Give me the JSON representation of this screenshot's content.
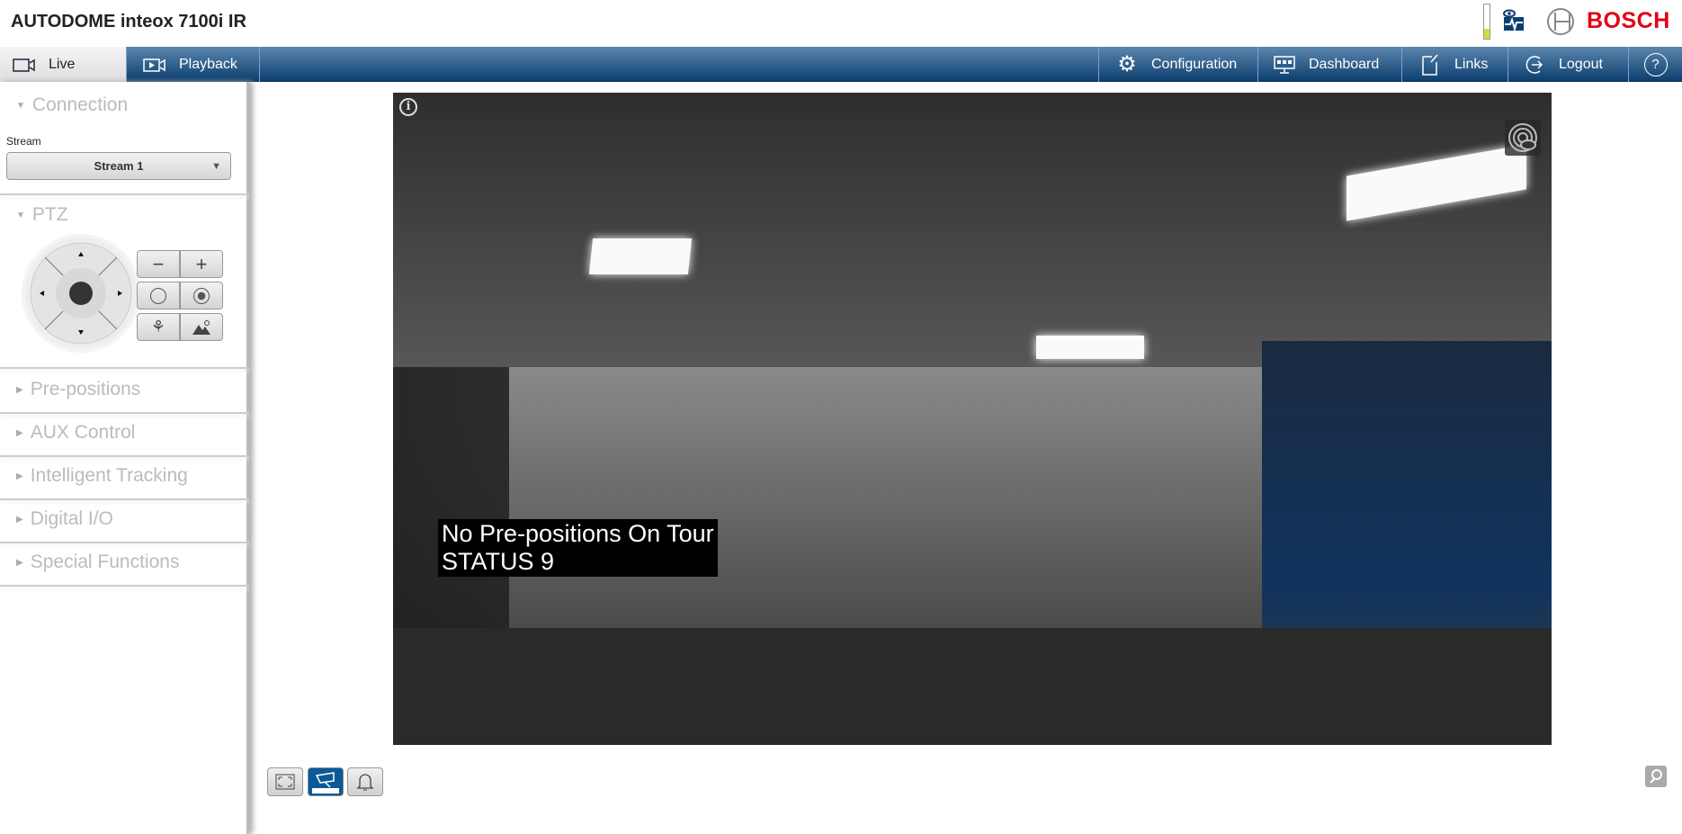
{
  "header": {
    "title": "AUTODOME inteox 7100i IR",
    "brand": "BOSCH",
    "level_fraction": 0.3,
    "level_color": "#d4dd3a",
    "brand_color": "#e20015"
  },
  "nav": {
    "left": [
      {
        "label": "Live",
        "icon": "camera-icon",
        "active": true
      },
      {
        "label": "Playback",
        "icon": "playback-icon"
      }
    ],
    "right": [
      {
        "label": "Configuration",
        "icon": "gear-icon"
      },
      {
        "label": "Dashboard",
        "icon": "monitor-icon"
      },
      {
        "label": "Links",
        "icon": "link-icon"
      },
      {
        "label": "Logout",
        "icon": "logout-icon"
      },
      {
        "label": "?",
        "icon": "help-icon"
      }
    ]
  },
  "sidebar": {
    "connection": {
      "title": "Connection",
      "stream_label": "Stream",
      "stream_value": "Stream 1"
    },
    "ptz": {
      "title": "PTZ",
      "zoom_out": "−",
      "zoom_in": "+"
    },
    "sections": [
      "Pre-positions",
      "AUX Control",
      "Intelligent Tracking",
      "Digital I/O",
      "Special Functions"
    ]
  },
  "video": {
    "overlay_line1": "No Pre-positions On Tour",
    "overlay_line2": "STATUS 9",
    "info_glyph": "i"
  }
}
